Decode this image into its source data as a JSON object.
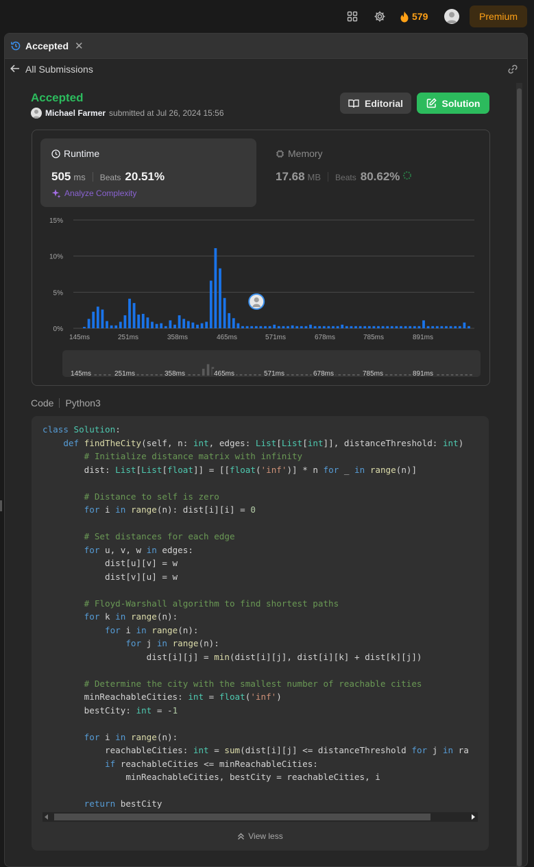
{
  "topbar": {
    "streak_count": "579",
    "premium_label": "Premium"
  },
  "tab": {
    "label": "Accepted"
  },
  "nav": {
    "back_label": "All Submissions"
  },
  "submission": {
    "status": "Accepted",
    "user": "Michael Farmer",
    "submitted_text": "submitted at Jul 26, 2024 15:56"
  },
  "actions": {
    "editorial_label": "Editorial",
    "solution_label": "Solution"
  },
  "runtime": {
    "title": "Runtime",
    "value": "505",
    "unit": "ms",
    "beats_label": "Beats",
    "beats_value": "20.51%",
    "analyze_label": "Analyze Complexity"
  },
  "memory": {
    "title": "Memory",
    "value": "17.68",
    "unit": "MB",
    "beats_label": "Beats",
    "beats_value": "80.62%"
  },
  "colors": {
    "accent_green": "#2cbb5d",
    "bar_blue": "#1a73e8",
    "premium_orange": "#ffa116",
    "analyze_purple": "#8a63d2"
  },
  "chart_data": {
    "type": "bar",
    "y_ticks": [
      "15%",
      "10%",
      "5%",
      "0%"
    ],
    "ylim": [
      0,
      15
    ],
    "x_ticks": [
      "145ms",
      "251ms",
      "358ms",
      "465ms",
      "571ms",
      "678ms",
      "785ms",
      "891ms"
    ],
    "x_range_ms": [
      145,
      1000
    ],
    "grid": true,
    "user_marker_ms": 505,
    "series": [
      {
        "values": [
          0.2,
          1.3,
          2.3,
          3.0,
          2.6,
          1.0,
          0.4,
          0.4,
          0.9,
          1.8,
          4.1,
          3.5,
          1.9,
          2.0,
          1.5,
          0.9,
          0.6,
          0.7,
          0.3,
          1.1,
          0.5,
          1.8,
          1.3,
          1.0,
          0.8,
          0.5,
          0.7,
          0.9,
          6.6,
          11.1,
          8.3,
          4.2,
          2.1,
          1.4,
          0.7,
          0.3,
          0.3,
          0.3,
          0.3,
          0.3,
          0.3,
          0.3,
          0.5,
          0.3,
          0.3,
          0.3,
          0.4,
          0.3,
          0.3,
          0.3,
          0.5,
          0.3,
          0.3,
          0.3,
          0.3,
          0.3,
          0.3,
          0.5,
          0.3,
          0.3,
          0.3,
          0.3,
          0.3,
          0.3,
          0.3,
          0.3,
          0.3,
          0.3,
          0.3,
          0.3,
          0.3,
          0.3,
          0.3,
          0.3,
          0.3,
          1.1,
          0.3,
          0.3,
          0.3,
          0.3,
          0.3,
          0.3,
          0.3,
          0.3,
          0.8,
          0.3
        ]
      }
    ]
  },
  "code": {
    "label": "Code",
    "language": "Python3",
    "view_less": "View less",
    "lines": [
      "class Solution:",
      "    def findTheCity(self, n: int, edges: List[List[int]], distanceThreshold: int)",
      "        # Initialize distance matrix with infinity",
      "        dist: List[List[float]] = [[float('inf')] * n for _ in range(n)]",
      "",
      "        # Distance to self is zero",
      "        for i in range(n): dist[i][i] = 0",
      "",
      "        # Set distances for each edge",
      "        for u, v, w in edges:",
      "            dist[u][v] = w",
      "            dist[v][u] = w",
      "",
      "        # Floyd-Warshall algorithm to find shortest paths",
      "        for k in range(n):",
      "            for i in range(n):",
      "                for j in range(n):",
      "                    dist[i][j] = min(dist[i][j], dist[i][k] + dist[k][j])",
      "",
      "        # Determine the city with the smallest number of reachable cities",
      "        minReachableCities: int = float('inf')",
      "        bestCity: int = -1",
      "",
      "        for i in range(n):",
      "            reachableCities: int = sum(dist[i][j] <= distanceThreshold for j in ra",
      "            if reachableCities <= minReachableCities:",
      "                minReachableCities, bestCity = reachableCities, i",
      "",
      "        return bestCity"
    ]
  }
}
